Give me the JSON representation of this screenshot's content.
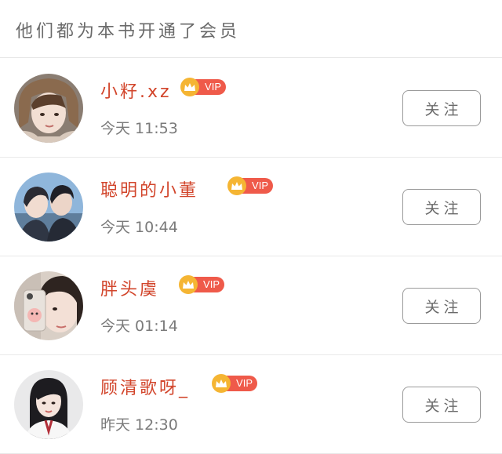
{
  "header": {
    "title": "他们都为本书开通了会员"
  },
  "vip_badge": {
    "label": "VIP",
    "crown_color": "#f5b533",
    "pill_color": "#ef5a4a"
  },
  "accent_name_color": "#d2452b",
  "members": [
    {
      "name": "小籽.xz",
      "time": "今天 11:53",
      "follow_label": "关注",
      "avatar_icon": "avatar-girl-knit-hat"
    },
    {
      "name": "聪明的小董",
      "time": "今天 10:44",
      "follow_label": "关注",
      "avatar_icon": "avatar-couple"
    },
    {
      "name": "胖头虞",
      "time": "今天 01:14",
      "follow_label": "关注",
      "avatar_icon": "avatar-girl-phone-selfie"
    },
    {
      "name": "顾清歌呀_",
      "time": "昨天 12:30",
      "follow_label": "关注",
      "avatar_icon": "avatar-girl-long-hair"
    }
  ]
}
